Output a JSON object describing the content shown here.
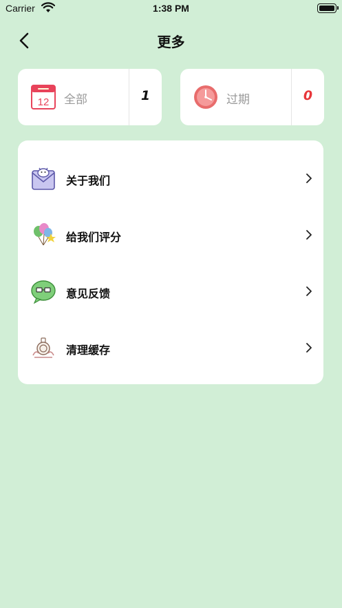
{
  "status_bar": {
    "carrier": "Carrier",
    "time": "1:38 PM"
  },
  "nav": {
    "title": "更多",
    "back_icon": "chevron-left-icon"
  },
  "stats": [
    {
      "label": "全部",
      "count": "1",
      "icon": "calendar-icon",
      "calendar_day": "12",
      "count_color": "#111111"
    },
    {
      "label": "过期",
      "count": "0",
      "icon": "clock-icon",
      "count_color": "#e8363a"
    }
  ],
  "menu": {
    "items": [
      {
        "label": "关于我们",
        "icon": "envelope-icon"
      },
      {
        "label": "给我们评分",
        "icon": "balloons-icon"
      },
      {
        "label": "意见反馈",
        "icon": "chat-bubble-icon"
      },
      {
        "label": "清理缓存",
        "icon": "pot-icon"
      }
    ]
  },
  "colors": {
    "background": "#d1eed6",
    "card": "#ffffff",
    "expired_count": "#e8363a"
  }
}
